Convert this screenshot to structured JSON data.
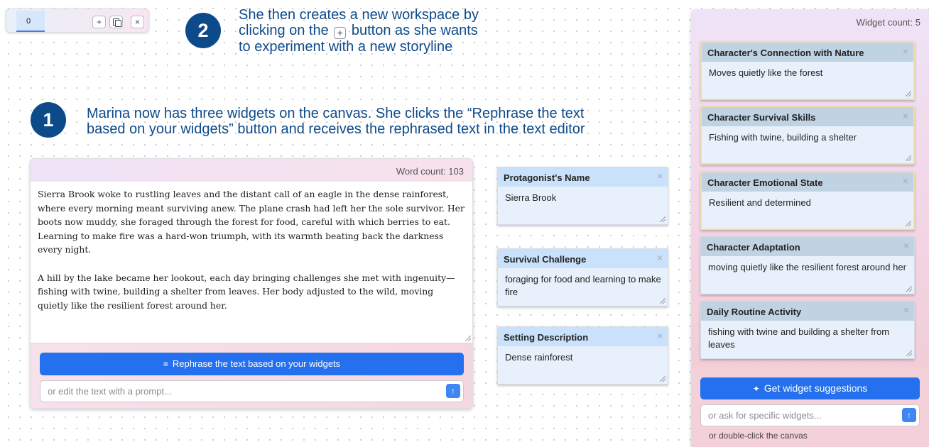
{
  "workspace_bar": {
    "active_tab": "0",
    "add_symbol": "+",
    "close_symbol": "×"
  },
  "annotations": {
    "step1": {
      "number": "1",
      "line1": "Marina now has three widgets on the canvas. She clicks the “Rephrase the text",
      "line2": "based on your widgets” button and receives the rephrased text in the text editor"
    },
    "step2": {
      "number": "2",
      "line1": "She then creates a new workspace by",
      "line2_before": "clicking on the",
      "line2_icon": "+",
      "line2_after": "button as she wants",
      "line3": "to experiment with a new storyline"
    }
  },
  "editor": {
    "word_count": "Word count: 103",
    "paragraph1": "Sierra Brook woke to rustling leaves and the distant call of an eagle in the dense rainforest, where every morning meant surviving anew. The plane crash had left her the sole survivor. Her boots now muddy, she foraged through the forest for food, careful with which berries to eat. Learning to make fire was a hard-won triumph, with its warmth beating back the darkness every night.",
    "paragraph2": "A hill by the lake became her lookout, each day bringing challenges she met with ingenuity—fishing with twine, building a shelter from leaves. Her body adjusted to the wild, moving quietly like the resilient forest around her.",
    "rephrase_button": "Rephrase the text based on your widgets",
    "rephrase_icon": "edit-lines-icon",
    "prompt_placeholder": "or edit the text with a prompt...",
    "send_icon": "↑"
  },
  "canvas_widgets": [
    {
      "title": "Protagonist's Name",
      "value": "Sierra Brook"
    },
    {
      "title": "Survival Challenge",
      "value": "foraging for food and learning to make fire"
    },
    {
      "title": "Setting Description",
      "value": "Dense rainforest"
    }
  ],
  "panel": {
    "widget_count": "Widget count: 5",
    "widgets": [
      {
        "title": "Character's Connection with Nature",
        "value": "Moves quietly like the forest"
      },
      {
        "title": "Character Survival Skills",
        "value": "Fishing with twine, building a shelter"
      },
      {
        "title": "Character Emotional State",
        "value": "Resilient and determined"
      },
      {
        "title": "Character Adaptation",
        "value": "moving quietly like the resilient forest around her"
      },
      {
        "title": "Daily Routine Activity",
        "value": "fishing with twine and building a shelter from leaves"
      }
    ],
    "suggest_button": "Get widget suggestions",
    "suggest_icon": "sparkle-icon",
    "ask_placeholder": "or ask for specific widgets...",
    "send_icon": "↑",
    "hint": "or double-click the canvas"
  },
  "colors": {
    "annotation": "#0d4a8a",
    "primary_button": "#2470ee",
    "widget_header_blue": "#c9e1fb",
    "widget_header_slate": "#bfd3e2"
  }
}
